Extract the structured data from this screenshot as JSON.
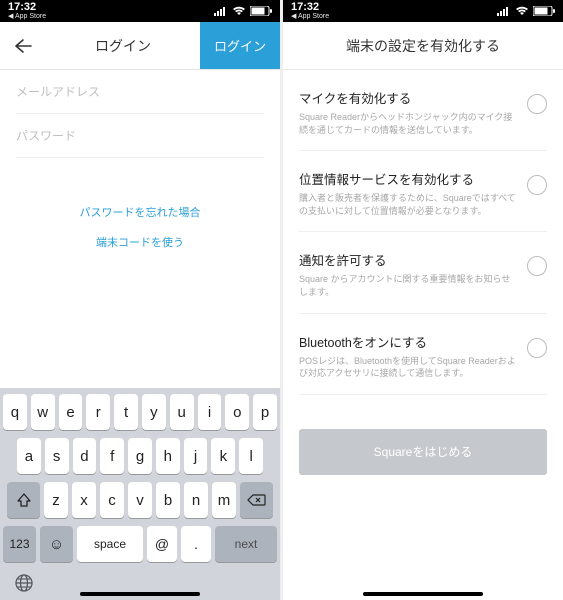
{
  "statusbar": {
    "time": "17:32",
    "home_label": "App Store"
  },
  "left": {
    "header": {
      "title": "ログイン",
      "submit": "ログイン"
    },
    "fields": {
      "email_placeholder": "メールアドレス",
      "password_placeholder": "パスワード"
    },
    "links": {
      "forgot": "パスワードを忘れた場合",
      "device_code": "端末コードを使う"
    },
    "keyboard": {
      "row1": [
        "q",
        "w",
        "e",
        "r",
        "t",
        "y",
        "u",
        "i",
        "o",
        "p"
      ],
      "row2": [
        "a",
        "s",
        "d",
        "f",
        "g",
        "h",
        "j",
        "k",
        "l"
      ],
      "row3": [
        "z",
        "x",
        "c",
        "v",
        "b",
        "n",
        "m"
      ],
      "num": "123",
      "space": "space",
      "at": "@",
      "dot": ".",
      "next": "next"
    }
  },
  "right": {
    "title": "端末の設定を有効化する",
    "items": [
      {
        "title": "マイクを有効化する",
        "desc": "Square Readerからヘッドホンジャック内のマイク接続を通じてカードの情報を送信しています。"
      },
      {
        "title": "位置情報サービスを有効化する",
        "desc": "購入者と販売者を保護するために、Squareではすべての支払いに対して位置情報が必要となります。"
      },
      {
        "title": "通知を許可する",
        "desc": "Square からアカウントに関する重要情報をお知らせします。"
      },
      {
        "title": "Bluetoothをオンにする",
        "desc": "POSレジは、Bluetoothを使用してSquare Readerおよび対応アクセサリに接続して通信します。"
      }
    ],
    "start_button": "Squareをはじめる"
  }
}
